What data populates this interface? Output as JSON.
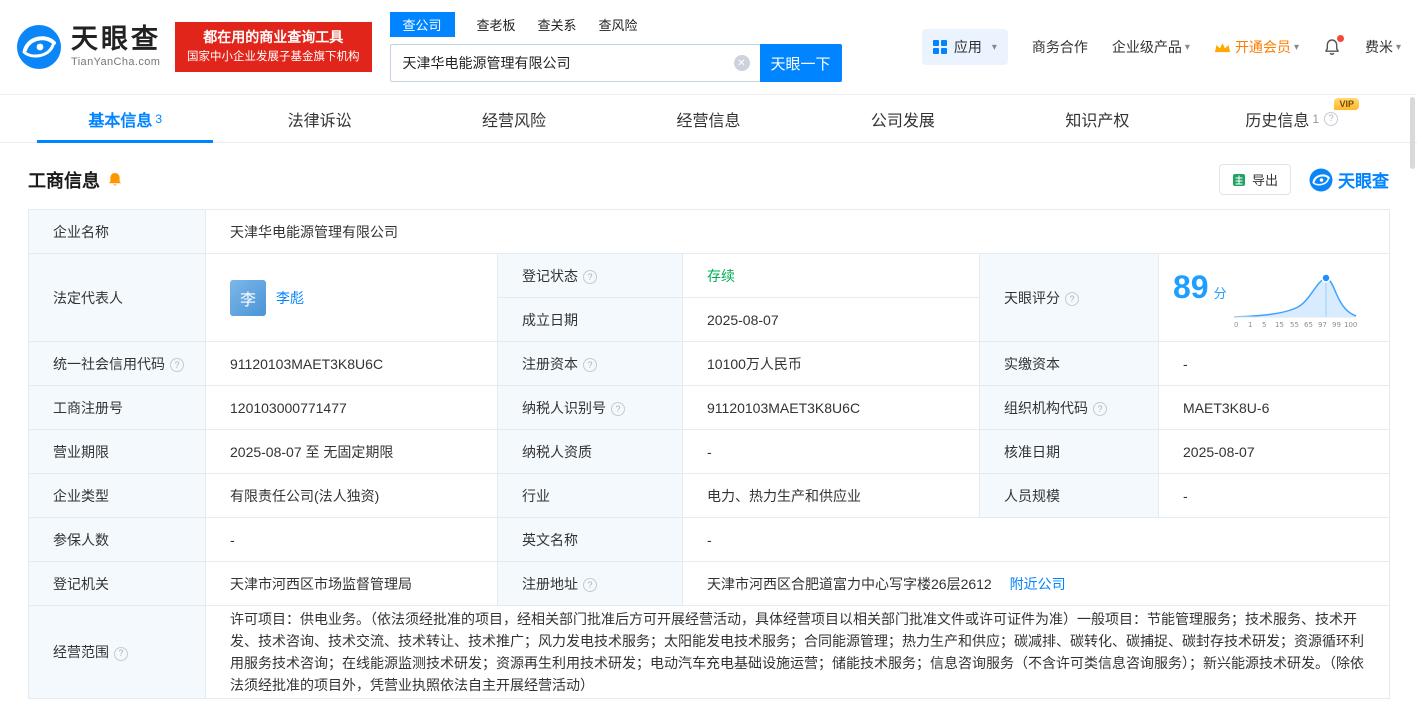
{
  "icons": {
    "caret": "▾",
    "help": "?",
    "clear": "✕"
  },
  "colors": {
    "brand_blue": "#0084ff",
    "status_green": "#00b151",
    "vip_orange": "#ff8a00",
    "slogan_red": "#e1251b"
  },
  "header": {
    "logo": {
      "title": "天眼查",
      "subtitle": "TianYanCha.com"
    },
    "slogan": {
      "line1": "都在用的商业查询工具",
      "line2": "国家中小企业发展子基金旗下机构"
    },
    "search": {
      "tabs": [
        {
          "label": "查公司"
        },
        {
          "label": "查老板"
        },
        {
          "label": "查关系"
        },
        {
          "label": "查风险"
        }
      ],
      "value": "天津华电能源管理有限公司",
      "button": "天眼一下"
    },
    "nav": {
      "apps": "应用",
      "cooperation": "商务合作",
      "enterprise": "企业级产品",
      "membership": "开通会员",
      "username": "费米"
    }
  },
  "tabs": {
    "items": [
      {
        "label": "基本信息",
        "count": "3"
      },
      {
        "label": "法律诉讼",
        "count": ""
      },
      {
        "label": "经营风险",
        "count": ""
      },
      {
        "label": "经营信息",
        "count": ""
      },
      {
        "label": "公司发展",
        "count": ""
      },
      {
        "label": "知识产权",
        "count": ""
      },
      {
        "label": "历史信息",
        "count": "1"
      }
    ],
    "vip_badge": "VIP"
  },
  "section": {
    "title": "工商信息",
    "export": "导出",
    "brand": "天眼查"
  },
  "table": {
    "company_name": {
      "label": "企业名称",
      "value": "天津华电能源管理有限公司"
    },
    "legal_rep": {
      "label": "法定代表人",
      "avatar": "李",
      "value": "李彪"
    },
    "reg_status": {
      "label": "登记状态",
      "value": "存续"
    },
    "establish_date": {
      "label": "成立日期",
      "value": "2025-08-07"
    },
    "score": {
      "label": "天眼评分",
      "value": "89",
      "unit": "分"
    },
    "credit_code": {
      "label": "统一社会信用代码",
      "value": "91120103MAET3K8U6C"
    },
    "reg_capital": {
      "label": "注册资本",
      "value": "10100万人民币"
    },
    "paid_capital": {
      "label": "实缴资本",
      "value": "-"
    },
    "reg_no": {
      "label": "工商注册号",
      "value": "120103000771477"
    },
    "taxpayer_no": {
      "label": "纳税人识别号",
      "value": "91120103MAET3K8U6C"
    },
    "org_code": {
      "label": "组织机构代码",
      "value": "MAET3K8U-6"
    },
    "term": {
      "label": "营业期限",
      "value": "2025-08-07 至 无固定期限"
    },
    "taxpayer_quality": {
      "label": "纳税人资质",
      "value": "-"
    },
    "approval_date": {
      "label": "核准日期",
      "value": "2025-08-07"
    },
    "company_type": {
      "label": "企业类型",
      "value": "有限责任公司(法人独资)"
    },
    "industry": {
      "label": "行业",
      "value": "电力、热力生产和供应业"
    },
    "staff_size": {
      "label": "人员规模",
      "value": "-"
    },
    "insured": {
      "label": "参保人数",
      "value": "-"
    },
    "english_name": {
      "label": "英文名称",
      "value": "-"
    },
    "authority": {
      "label": "登记机关",
      "value": "天津市河西区市场监督管理局"
    },
    "address": {
      "label": "注册地址",
      "value": "天津市河西区合肥道富力中心写字楼26层2612",
      "link": "附近公司"
    },
    "scope": {
      "label": "经营范围",
      "value": "许可项目：供电业务。（依法须经批准的项目，经相关部门批准后方可开展经营活动，具体经营项目以相关部门批准文件或许可证件为准）一般项目：节能管理服务；技术服务、技术开发、技术咨询、技术交流、技术转让、技术推广；风力发电技术服务；太阳能发电技术服务；合同能源管理；热力生产和供应；碳减排、碳转化、碳捕捉、碳封存技术研发；资源循环利用服务技术咨询；在线能源监测技术研发；资源再生利用技术研发；电动汽车充电基础设施运营；储能技术服务；信息咨询服务（不含许可类信息咨询服务）；新兴能源技术研发。（除依法须经批准的项目外，凭营业执照依法自主开展经营活动）"
    }
  },
  "score_chart": {
    "type": "area",
    "score": 89,
    "ticks": [
      "0",
      "1",
      "5",
      "15",
      "55",
      "65",
      "97",
      "99",
      "100"
    ]
  }
}
